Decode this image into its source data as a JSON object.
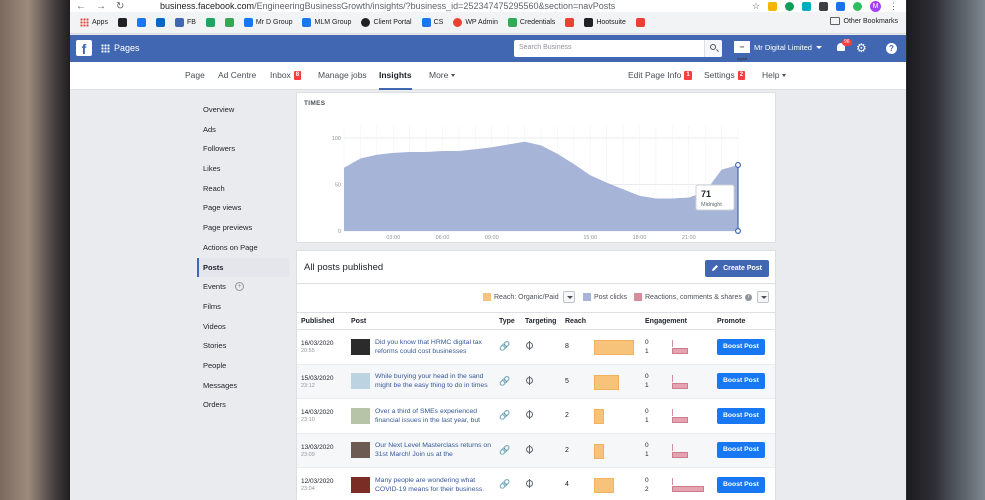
{
  "browser": {
    "url_host": "business.facebook.com",
    "url_path": "/EngineeringBusinessGrowth/insights/?business_id=252347475295560&section=navPosts",
    "bookmarks": [
      {
        "label": "Apps",
        "color": "#e94235"
      },
      {
        "label": "",
        "color": "#202124"
      },
      {
        "label": "",
        "color": "#1877f2"
      },
      {
        "label": "",
        "color": "#0a66c2"
      },
      {
        "label": "FB",
        "color": "#4267b2"
      },
      {
        "label": "",
        "color": "#1fa463"
      },
      {
        "label": "",
        "color": "#34a853"
      },
      {
        "label": "Mr D Group",
        "color": "#1877f2"
      },
      {
        "label": "MLM Group",
        "color": "#1877f2"
      },
      {
        "label": "Client Portal",
        "color": "#202124"
      },
      {
        "label": "CS",
        "color": "#1877f2"
      },
      {
        "label": "WP Admin",
        "color": "#e94235"
      },
      {
        "label": "Credentials",
        "color": "#34a853"
      },
      {
        "label": "",
        "color": "#e94235"
      },
      {
        "label": "Hootsuite",
        "color": "#202124"
      },
      {
        "label": "",
        "color": "#e94235"
      }
    ],
    "other_bookmarks": "Other Bookmarks",
    "profile_initial": "M"
  },
  "fb": {
    "pages_label": "Pages",
    "search_placeholder": "Search Business",
    "page_name": "Mr Digital Limited",
    "notif_count": "96"
  },
  "tabs": [
    {
      "label": "Page",
      "badge": ""
    },
    {
      "label": "Ad Centre",
      "badge": ""
    },
    {
      "label": "Inbox",
      "badge": "8"
    },
    {
      "label": "Manage jobs",
      "badge": ""
    },
    {
      "label": "Insights",
      "badge": ""
    },
    {
      "label": "More",
      "badge": ""
    },
    {
      "label": "Edit Page Info",
      "badge": "1"
    },
    {
      "label": "Settings",
      "badge": "2"
    },
    {
      "label": "Help",
      "badge": ""
    }
  ],
  "sidebar": [
    "Overview",
    "Ads",
    "Followers",
    "Likes",
    "Reach",
    "Page views",
    "Page previews",
    "Actions on Page",
    "Posts",
    "Events",
    "Films",
    "Videos",
    "Stories",
    "People",
    "Messages",
    "Orders"
  ],
  "chart_card": {
    "title": "TIMES",
    "tooltip_value": "71",
    "tooltip_label": "Midnight"
  },
  "chart_data": {
    "type": "area",
    "title": "TIMES",
    "x_ticks": [
      "03:00",
      "06:00",
      "09:00",
      "15:00",
      "18:00",
      "21:00"
    ],
    "y_ticks": [
      "0",
      "50",
      "100"
    ],
    "ylim": [
      0,
      100
    ],
    "series": [
      {
        "values": [
          68,
          78,
          82,
          84,
          85,
          85,
          86,
          86,
          88,
          90,
          93,
          96,
          92,
          83,
          72,
          60,
          52,
          45,
          38,
          35,
          35,
          36,
          42,
          66,
          71
        ]
      }
    ],
    "highlight": {
      "label": "Midnight",
      "value": 71
    },
    "color": "#a6b4d8"
  },
  "posts": {
    "title": "All posts published",
    "create_label": "Create Post",
    "legend": [
      {
        "label": "Reach: Organic/Paid",
        "color": "#f7c37b"
      },
      {
        "label": "Post clicks",
        "color": "#a6b4d8"
      },
      {
        "label": "Reactions, comments & shares",
        "color": "#d58e9d"
      }
    ],
    "columns": [
      "Published",
      "Post",
      "Type",
      "Targeting",
      "Reach",
      "Engagement",
      "Promote"
    ],
    "boost_label": "Boost Post",
    "rows": [
      {
        "date": "16/03/2020",
        "time": "20:55",
        "text": "Did you know that HRMC digital tax reforms could cost businesses",
        "reach": "8",
        "reach_pct": 1.0,
        "eng1": "0",
        "eng2": "1",
        "eng_pct": 0.45,
        "thumb": "#2b2b2b"
      },
      {
        "date": "15/03/2020",
        "time": "23:12",
        "text": "While burying your head in the sand might be the easy thing to do in times",
        "reach": "5",
        "reach_pct": 0.63,
        "eng1": "0",
        "eng2": "1",
        "eng_pct": 0.45,
        "thumb": "#bcd3e2"
      },
      {
        "date": "14/03/2020",
        "time": "23:10",
        "text": "Over a third of SMEs experienced financial issues in the last year, but",
        "reach": "2",
        "reach_pct": 0.25,
        "eng1": "0",
        "eng2": "1",
        "eng_pct": 0.45,
        "thumb": "#b7c4a8"
      },
      {
        "date": "13/03/2020",
        "time": "23:09",
        "text": "Our Next Level Masterclass returns on 31st March! Join us at the",
        "reach": "2",
        "reach_pct": 0.25,
        "eng1": "0",
        "eng2": "1",
        "eng_pct": 0.45,
        "thumb": "#6c5b52"
      },
      {
        "date": "12/03/2020",
        "time": "23:04",
        "text": "Many people are wondering what COVID-19 means for their business.",
        "reach": "4",
        "reach_pct": 0.5,
        "eng1": "0",
        "eng2": "2",
        "eng_pct": 0.9,
        "thumb": "#7a2d24"
      }
    ]
  }
}
